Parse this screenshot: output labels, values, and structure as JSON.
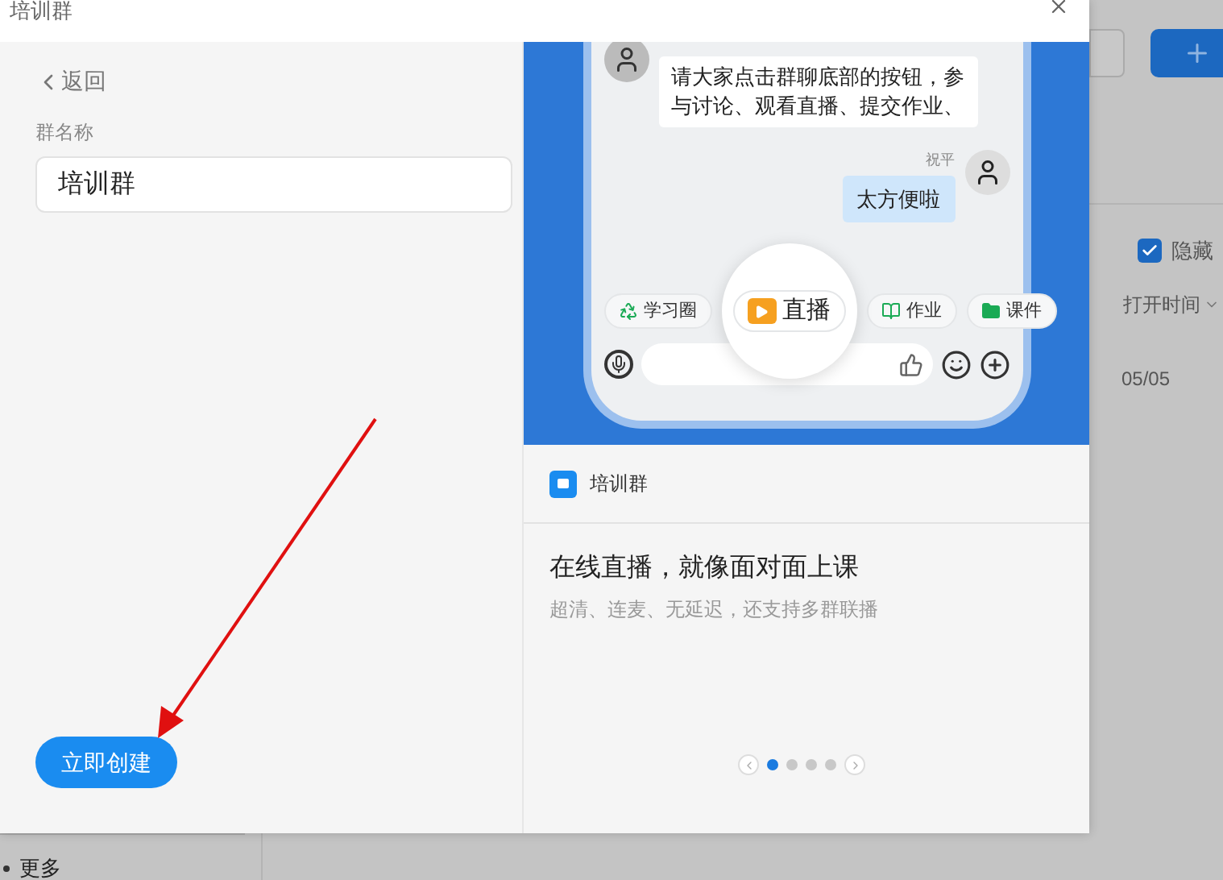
{
  "dialog": {
    "title": "培训群",
    "back_link": "返回",
    "name_field": {
      "label": "群名称",
      "value": "培训群"
    },
    "create_button": "立即创建",
    "preview": {
      "messages": [
        {
          "kind": "incoming",
          "text": "请大家点击群聊底部的按钮，参与讨论、观看直播、提交作业、"
        },
        {
          "kind": "outgoing",
          "sender": "祝平",
          "text": "太方便啦"
        }
      ],
      "toolbar": [
        {
          "label": "学习圈",
          "kind": "circle"
        },
        {
          "label": "直播",
          "kind": "live"
        },
        {
          "label": "作业",
          "kind": "book"
        },
        {
          "label": "课件",
          "kind": "folder"
        }
      ],
      "group_name": "培训群",
      "headline": "在线直播，就像面对面上课",
      "subtitle": "超清、连麦、无延迟，还支持多群联播",
      "dots": [
        {
          "selected": true
        },
        {
          "selected": false
        },
        {
          "selected": false
        },
        {
          "selected": false
        }
      ]
    }
  },
  "background": {
    "checkbox": {
      "label": "隐藏",
      "checked": true
    },
    "sort_label": "打开时间",
    "date": "05/05",
    "more": "更多"
  }
}
